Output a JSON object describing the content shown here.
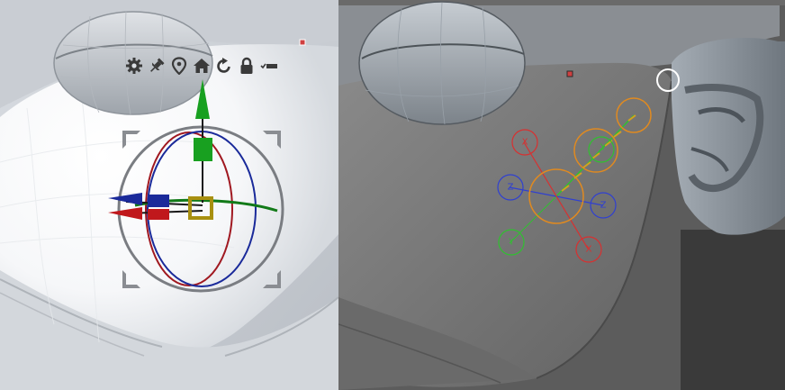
{
  "left_viewport": {
    "toolbar": {
      "icons": [
        "gear-icon",
        "pin-icon",
        "location-marker-icon",
        "home-icon",
        "rotate-icon",
        "lock-icon",
        "toggle-icon"
      ]
    },
    "gizmo": {
      "axis_colors": {
        "x": "#c0181c",
        "y": "#18a020",
        "z": "#1a2a9a"
      },
      "center_color": "#a89010"
    }
  },
  "right_viewport": {
    "transpose_line": {
      "axis_labels": {
        "z_left": "Z",
        "z_right": "Z",
        "x_top": "X",
        "x_bottom": "X",
        "y_bottom": "Y",
        "y_small": "Y"
      },
      "colors": {
        "x": "#d83030",
        "y": "#30c030",
        "z": "#3040d0",
        "ring": "#e08a20"
      }
    }
  }
}
